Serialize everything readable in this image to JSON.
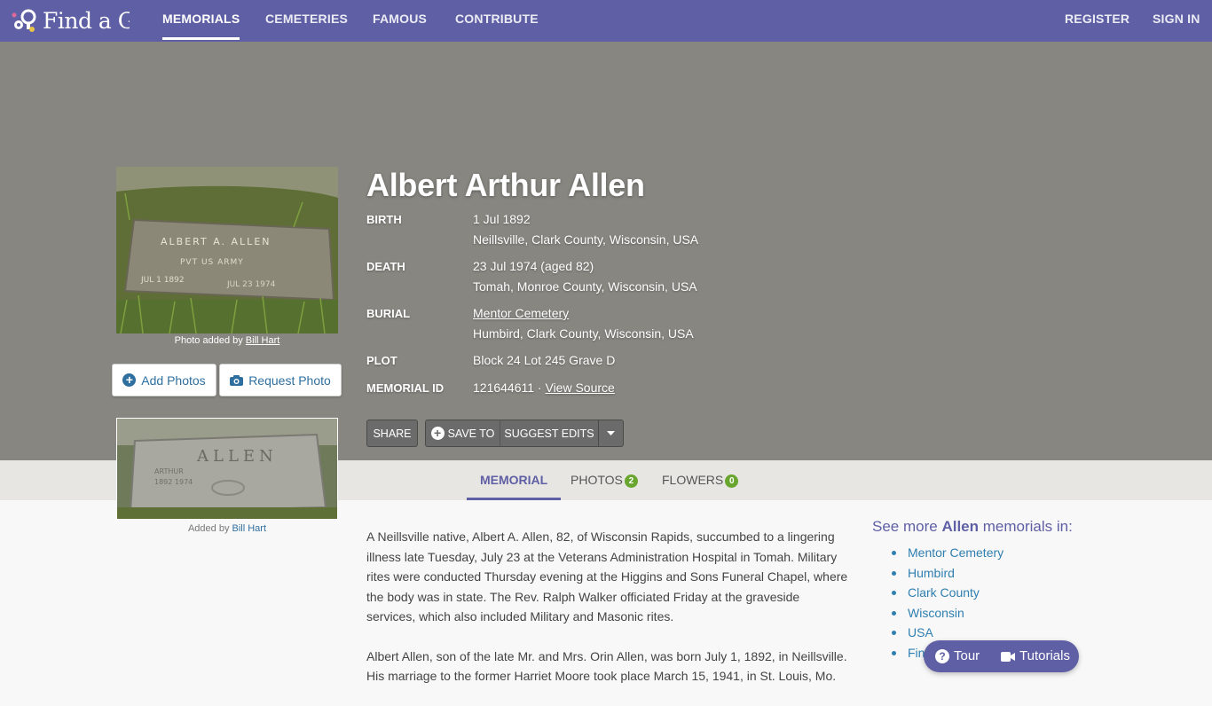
{
  "nav": {
    "logo_text": "Find a Grave",
    "links": [
      "MEMORIALS",
      "CEMETERIES",
      "FAMOUS",
      "CONTRIBUTE"
    ],
    "register": "REGISTER",
    "sign_in": "SIGN IN"
  },
  "memorial": {
    "name": "Albert Arthur Allen",
    "photo_caption_prefix": "Photo added by ",
    "photo_caption_author": "Bill Hart",
    "add_photos": "Add Photos",
    "request_photo": "Request Photo",
    "facts": {
      "birth_label": "BIRTH",
      "birth_date": "1 Jul 1892",
      "birth_place": "Neillsville, Clark County, Wisconsin, USA",
      "death_label": "DEATH",
      "death_date": "23 Jul 1974 (aged 82)",
      "death_place": "Tomah, Monroe County, Wisconsin, USA",
      "burial_label": "BURIAL",
      "burial_cemetery": "Mentor Cemetery",
      "burial_place": "Humbird, Clark County, Wisconsin, USA",
      "plot_label": "PLOT",
      "plot_value": "Block 24 Lot 245 Grave D",
      "id_label": "MEMORIAL ID",
      "id_value": "121644611 · ",
      "id_source": "View Source"
    },
    "actions": {
      "share": "SHARE",
      "save_to": "SAVE TO",
      "suggest_edits": "SUGGEST EDITS"
    }
  },
  "tabs": {
    "memorial": "MEMORIAL",
    "photos": "PHOTOS",
    "photos_count": "2",
    "flowers": "FLOWERS",
    "flowers_count": "0"
  },
  "second_photo": {
    "caption_prefix": "Added by ",
    "caption_author": "Bill Hart"
  },
  "bio": {
    "p1": "A Neillsville native, Albert A. Allen, 82, of Wisconsin Rapids, succumbed to a lingering illness late Tuesday, July 23 at the Veterans Administration Hospital in Tomah. Military rites were conducted Thursday evening at the Higgins and Sons Funeral Chapel, where the body was in state. The Rev. Ralph Walker officiated Friday at the graveside services, which also included Military and Masonic rites.",
    "p2": "Albert Allen, son of the late Mr. and Mrs. Orin Allen, was born July 1, 1892, in Neillsville. His marriage to the former Harriet Moore took place March 15, 1941, in St. Louis, Mo."
  },
  "see_more": {
    "prefix": "See more ",
    "surname": "Allen",
    "suffix": " memorials in:",
    "items": [
      "Mentor Cemetery",
      "Humbird",
      "Clark County",
      "Wisconsin",
      "USA",
      "Find a Grave"
    ]
  },
  "help": {
    "tour": "Tour",
    "tutorials": "Tutorials"
  },
  "stone_text": {
    "main_line1": "ALBERT A. ALLEN",
    "main_line2": "PVT US ARMY",
    "main_line3": "JUL 1 1892",
    "main_line4": "JUL 23 1974",
    "second_line1": "ALLEN",
    "second_line2": "ARTHUR",
    "second_line3": "1892 1974"
  }
}
